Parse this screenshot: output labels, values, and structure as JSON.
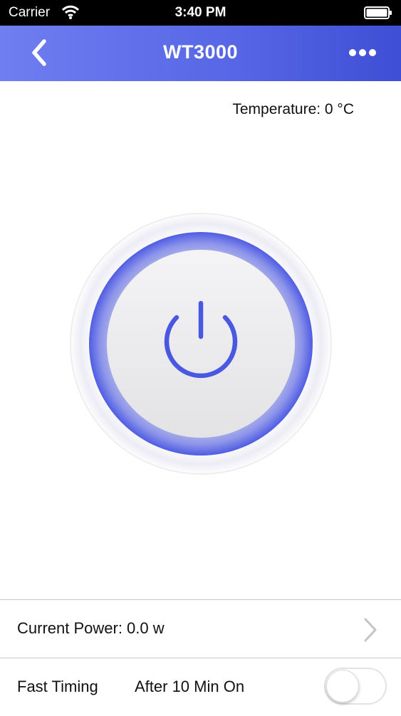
{
  "status_bar": {
    "carrier": "Carrier",
    "time": "3:40 PM"
  },
  "nav": {
    "title": "WT3000",
    "back_icon": "chevron-left-icon",
    "more_icon": "more-dots-icon",
    "background_start": "#6f7ef0",
    "background_end": "#3f4fd6"
  },
  "temperature": {
    "text": "Temperature: 0 °C"
  },
  "power_button": {
    "icon": "power-icon",
    "accent_color": "#4a57e0"
  },
  "rows": {
    "current_power": {
      "text": "Current Power: 0.0 w"
    },
    "fast_timing": {
      "label": "Fast Timing",
      "value": "After 10 Min On",
      "toggle_on": false
    }
  }
}
